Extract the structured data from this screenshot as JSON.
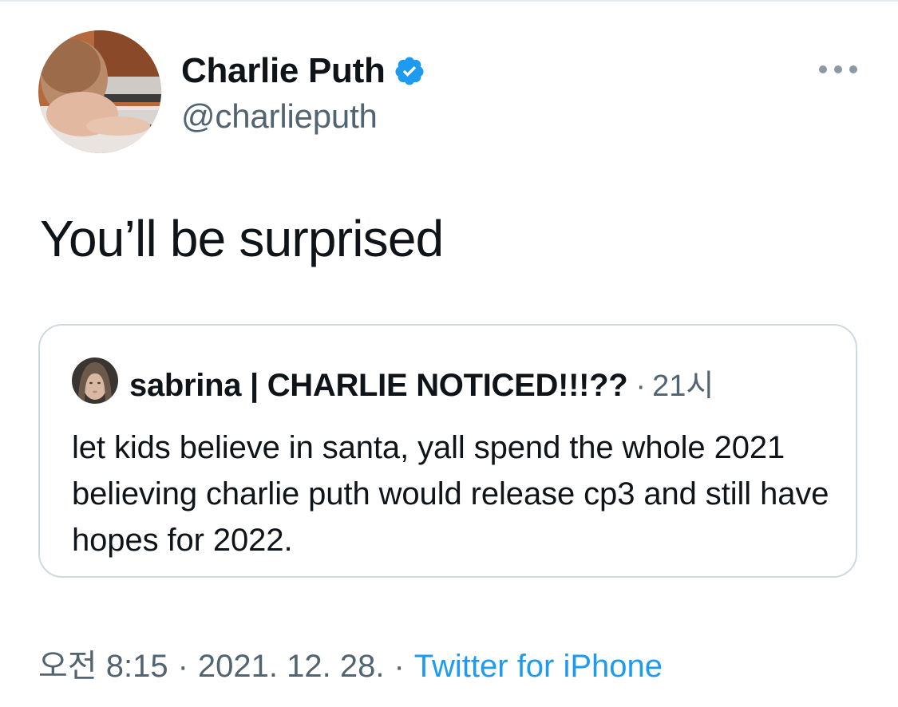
{
  "author": {
    "name": "Charlie Puth",
    "handle": "@charlieputh",
    "verified_color": "#1d9bf0"
  },
  "tweet": {
    "text": "You’ll be surprised"
  },
  "quoted_tweet": {
    "author_name": "sabrina | CHARLIE NOTICED!!!??",
    "separator": "·",
    "time": "21시",
    "text": "let kids believe in santa, yall spend the whole 2021 believing charlie puth would release cp3 and still have hopes for 2022."
  },
  "meta": {
    "time": "오전 8:15",
    "separator": "·",
    "date": "2021. 12. 28.",
    "source_separator": "·",
    "source": "Twitter for iPhone"
  },
  "icons": {
    "verified": "verified-badge-icon",
    "more": "more-options-icon"
  },
  "colors": {
    "accent": "#1d9bf0",
    "secondary_text": "#536471",
    "primary_text": "#0f1419",
    "border": "#cfd9de"
  }
}
